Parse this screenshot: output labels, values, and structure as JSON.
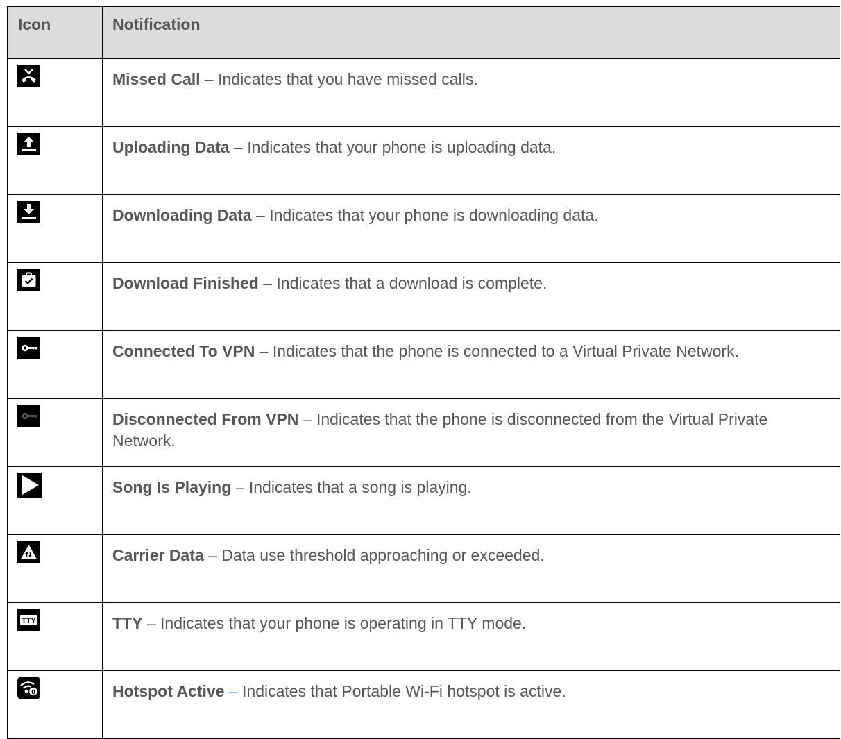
{
  "header": {
    "icon_label": "Icon",
    "notification_label": "Notification"
  },
  "rows": [
    {
      "icon": "missed-call-icon",
      "label": "Missed Call",
      "separator": " – ",
      "description": "Indicates that you have missed calls."
    },
    {
      "icon": "upload-icon",
      "label": "Uploading Data",
      "separator": " – ",
      "description": "Indicates that your phone is uploading data."
    },
    {
      "icon": "download-icon",
      "label": "Downloading Data",
      "separator": " – ",
      "description": "Indicates that your phone is downloading data."
    },
    {
      "icon": "download-finished-icon",
      "label": "Download Finished",
      "separator": " – ",
      "description": "Indicates that a download is complete."
    },
    {
      "icon": "vpn-key-icon",
      "label": "Connected To VPN",
      "separator": " – ",
      "description": "Indicates that the phone is connected to a Virtual Private Network."
    },
    {
      "icon": "vpn-key-dim-icon",
      "label": "Disconnected From VPN",
      "separator": " – ",
      "description": "Indicates that the phone is disconnected from the Virtual Private Network."
    },
    {
      "icon": "play-icon",
      "label": "Song Is Playing",
      "separator": " – ",
      "description": "Indicates that a song is playing."
    },
    {
      "icon": "data-warning-icon",
      "label": "Carrier Data",
      "separator": " – ",
      "description": "Data use threshold approaching or exceeded."
    },
    {
      "icon": "tty-icon",
      "label": "TTY",
      "separator": " – ",
      "description": "Indicates that your phone is operating in TTY mode."
    },
    {
      "icon": "hotspot-icon",
      "label": "Hotspot Active",
      "separator": " – ",
      "description": "Indicates that Portable Wi-Fi hotspot is active."
    }
  ],
  "icon_text": {
    "tty": "TTY",
    "hotspot_count": "0"
  },
  "colors": {
    "header_bg": "#dcdcdc",
    "text": "#575757",
    "border": "#000000",
    "hotspot_separator": "#2a9fd6"
  }
}
